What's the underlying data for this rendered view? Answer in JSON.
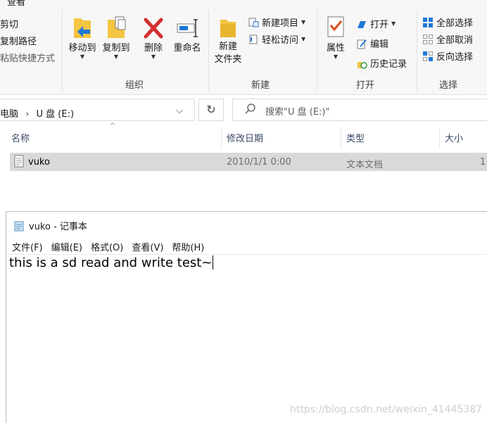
{
  "ribbon": {
    "tab_top": "查看",
    "clipboard": {
      "cut": "剪切",
      "copy_path": "复制路径",
      "paste_shortcut": "粘贴快捷方式"
    },
    "organize": {
      "move_to": "移动到",
      "copy_to": "复制到",
      "delete": "删除",
      "rename": "重命名",
      "label": "组织"
    },
    "new": {
      "new_item": "新建项目",
      "easy_access": "轻松访问",
      "new_folder_line1": "新建",
      "new_folder_line2": "文件夹",
      "label": "新建"
    },
    "open": {
      "properties": "属性",
      "open": "打开",
      "edit": "编辑",
      "history": "历史记录",
      "label": "打开"
    },
    "select": {
      "select_all": "全部选择",
      "select_none": "全部取消",
      "invert": "反向选择",
      "label": "选择"
    }
  },
  "address": {
    "path_root": "电脑",
    "path_sep": "›",
    "path_drive": "U 盘 (E:)",
    "search_placeholder": "搜索\"U 盘 (E:)\""
  },
  "columns": {
    "name": "名称",
    "modified": "修改日期",
    "type": "类型",
    "size": "大小"
  },
  "files": [
    {
      "name": "vuko",
      "modified": "2010/1/1 0:00",
      "type": "文本文档",
      "size": "1"
    }
  ],
  "notepad": {
    "title": "vuko - 记事本",
    "menu": [
      "文件(F)",
      "编辑(E)",
      "格式(O)",
      "查看(V)",
      "帮助(H)"
    ],
    "content": "this is a sd read and write test~"
  },
  "watermark": "https://blog.csdn.net/weixin_41445387",
  "colors": {
    "accent_blue": "#1e78d7",
    "folder_yellow": "#f4c542",
    "delete_red": "#d32f2f",
    "selected_row": "#d9d9d9"
  }
}
